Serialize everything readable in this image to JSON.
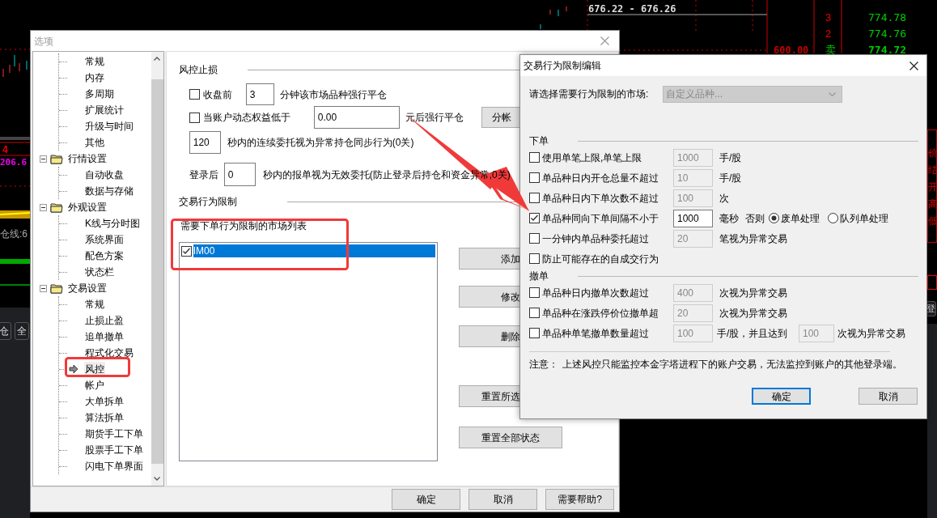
{
  "background": {
    "price_range": "676.22 - 676.26",
    "depth": [
      {
        "rank": "3",
        "price": "774.78",
        "bold": false
      },
      {
        "rank": "2",
        "price": "774.76",
        "bold": false
      },
      {
        "rank": "卖",
        "price": "774.72",
        "bold": true
      }
    ],
    "volume": "600.00",
    "left_readings": [
      "4",
      "206.6",
      "仓线:6"
    ],
    "left_buttons": [
      "仓",
      "全"
    ],
    "right_labels": [
      "价",
      "结",
      "开",
      "高",
      "低"
    ],
    "right_button": "登"
  },
  "options_dialog": {
    "title": "选项",
    "tree": [
      {
        "children": [
          {
            "label": "常规",
            "selected": false
          },
          {
            "label": "内存",
            "selected": false
          },
          {
            "label": "多周期",
            "selected": false
          },
          {
            "label": "扩展统计",
            "selected": false
          },
          {
            "label": "升级与时间",
            "selected": false
          },
          {
            "label": "其他",
            "selected": false
          }
        ]
      },
      {
        "label": "行情设置",
        "expanded": true,
        "children": [
          {
            "label": "自动收盘",
            "selected": false
          },
          {
            "label": "数据与存储",
            "selected": false
          }
        ]
      },
      {
        "label": "外观设置",
        "expanded": true,
        "children": [
          {
            "label": "K线与分时图",
            "selected": false
          },
          {
            "label": "系统界面",
            "selected": false
          },
          {
            "label": "配色方案",
            "selected": false
          },
          {
            "label": "状态栏",
            "selected": false
          }
        ]
      },
      {
        "label": "交易设置",
        "expanded": true,
        "children": [
          {
            "label": "常规",
            "selected": false
          },
          {
            "label": "止损止盈",
            "selected": false
          },
          {
            "label": "追单撤单",
            "selected": false
          },
          {
            "label": "程式化交易",
            "selected": false
          },
          {
            "label": "风控",
            "selected": true
          },
          {
            "label": "帐户",
            "selected": false
          },
          {
            "label": "大单拆单",
            "selected": false
          },
          {
            "label": "算法拆单",
            "selected": false
          },
          {
            "label": "期货手工下单",
            "selected": false
          },
          {
            "label": "股票手工下单",
            "selected": false
          },
          {
            "label": "闪电下单界面",
            "selected": false
          }
        ]
      }
    ],
    "stop_section": "风控止损",
    "close_before": {
      "label": "收盘前",
      "checked": false,
      "value": "3",
      "suffix": "分钟该市场品种强行平仓"
    },
    "equity_below": {
      "label": "当账户动态权益低于",
      "checked": false,
      "value": "0.00",
      "suffix": "元后强行平仓",
      "button": "分帐"
    },
    "sync_window": {
      "value": "120",
      "suffix": "秒内的连续委托视为异常持仓同步行为(0关)"
    },
    "after_login": {
      "label": "登录后",
      "value": "0",
      "suffix": "秒内的报单视为无效委托(防止登录后持仓和资金异常,0关)"
    },
    "limit_section": "交易行为限制",
    "market_list_label": "需要下单行为限制的市场列表",
    "markets": [
      {
        "label": "IM00",
        "checked": true,
        "selected": true
      }
    ],
    "list_buttons": [
      "添加",
      "修改",
      "删除",
      "重置所选",
      "重置全部状态"
    ],
    "footer_buttons": [
      "确定",
      "取消",
      "需要帮助?"
    ]
  },
  "edit_dialog": {
    "title": "交易行为限制编辑",
    "market_label": "请选择需要行为限制的市场:",
    "market_value": "自定义品种...",
    "order_section": "下单",
    "order_rules": [
      {
        "kind": "limit",
        "label": "使用单笔上限,单笔上限",
        "checked": false,
        "value": "1000",
        "unit": "手/股"
      },
      {
        "kind": "limit",
        "label": "单品种日内开仓总量不超过",
        "checked": false,
        "value": "10",
        "unit": "手/股"
      },
      {
        "kind": "limit",
        "label": "单品种日内下单次数不超过",
        "checked": false,
        "value": "100",
        "unit": "次"
      },
      {
        "kind": "interval",
        "label": "单品种同向下单间隔不小于",
        "checked": true,
        "value": "1000",
        "unit": "毫秒",
        "otherwise": "否则",
        "options": [
          {
            "label": "废单处理",
            "selected": true
          },
          {
            "label": "队列单处理",
            "selected": false
          }
        ]
      },
      {
        "kind": "limit",
        "label": "一分钟内单品种委托超过",
        "checked": false,
        "value": "20",
        "unit": "笔视为异常交易"
      },
      {
        "kind": "flag",
        "label": "防止可能存在的自成交行为",
        "checked": false
      }
    ],
    "cancel_section": "撤单",
    "cancel_rules": [
      {
        "kind": "limit",
        "label": "单品种日内撤单次数超过",
        "checked": false,
        "value": "400",
        "unit": "次视为异常交易"
      },
      {
        "kind": "limit",
        "label": "单品种在涨跌停价位撤单超",
        "checked": false,
        "value": "20",
        "unit": "次视为异常交易"
      },
      {
        "kind": "pair",
        "label": "单品种单笔撤单数量超过",
        "checked": false,
        "value": "100",
        "unit": "手/股，并且达到",
        "value2": "100",
        "unit2": "次视为异常交易"
      }
    ],
    "note_label": "注意：",
    "note": "上述风控只能监控本金字塔进程下的账户交易，无法监控到账户的其他登录端。",
    "buttons": [
      {
        "label": "确定",
        "default": true
      },
      {
        "label": "取消",
        "default": false
      }
    ]
  }
}
